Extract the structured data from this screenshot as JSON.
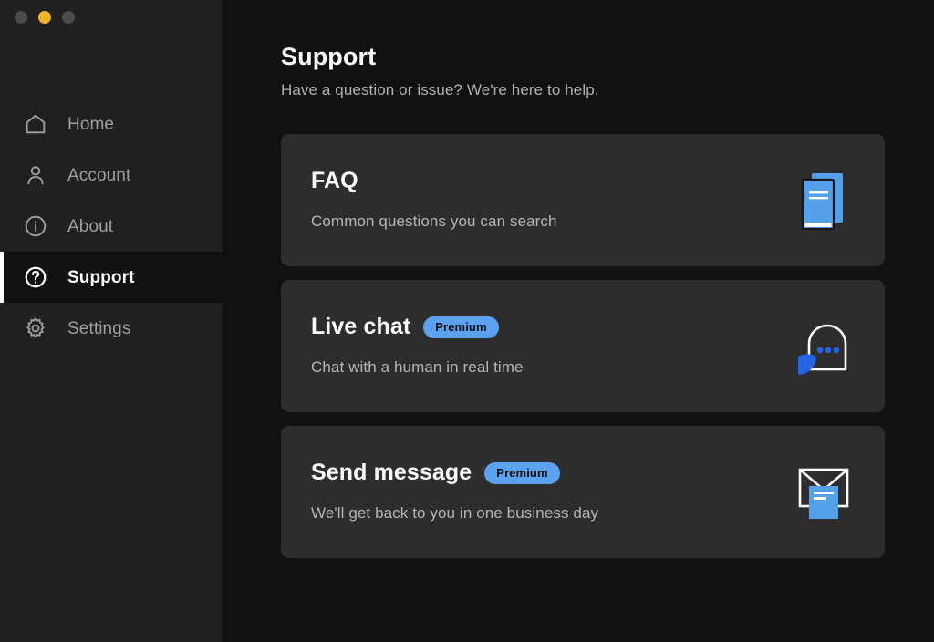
{
  "window": {
    "traffic_lights": [
      {
        "name": "close-button",
        "color": "#4a4a4a",
        "state": "inactive"
      },
      {
        "name": "minimize-button",
        "color": "#f0b429",
        "state": "active"
      },
      {
        "name": "maximize-button",
        "color": "#4a4a4a",
        "state": "inactive"
      }
    ]
  },
  "sidebar": {
    "items": [
      {
        "label": "Home",
        "icon": "home-icon",
        "active": false
      },
      {
        "label": "Account",
        "icon": "person-icon",
        "active": false
      },
      {
        "label": "About",
        "icon": "info-icon",
        "active": false
      },
      {
        "label": "Support",
        "icon": "question-icon",
        "active": true
      },
      {
        "label": "Settings",
        "icon": "gear-icon",
        "active": false
      }
    ]
  },
  "main": {
    "title": "Support",
    "subtitle": "Have a question or issue? We're here to help.",
    "cards": [
      {
        "title": "FAQ",
        "badge": null,
        "description": "Common questions you can search",
        "icon": "book-icon"
      },
      {
        "title": "Live chat",
        "badge": "Premium",
        "description": "Chat with a human in real time",
        "icon": "chat-bubble-icon"
      },
      {
        "title": "Send message",
        "badge": "Premium",
        "description": "We'll get back to you in one business day",
        "icon": "envelope-icon"
      }
    ]
  },
  "colors": {
    "sidebar_bg": "#202020",
    "main_bg": "#111111",
    "card_bg": "#2d2d2d",
    "accent_blue": "#5aa2f0",
    "deep_blue": "#2563e8",
    "badge_text": "#101010",
    "active_indicator": "#ffffff",
    "muted_text": "#b0b0b0",
    "nav_text": "#9e9e9e"
  }
}
